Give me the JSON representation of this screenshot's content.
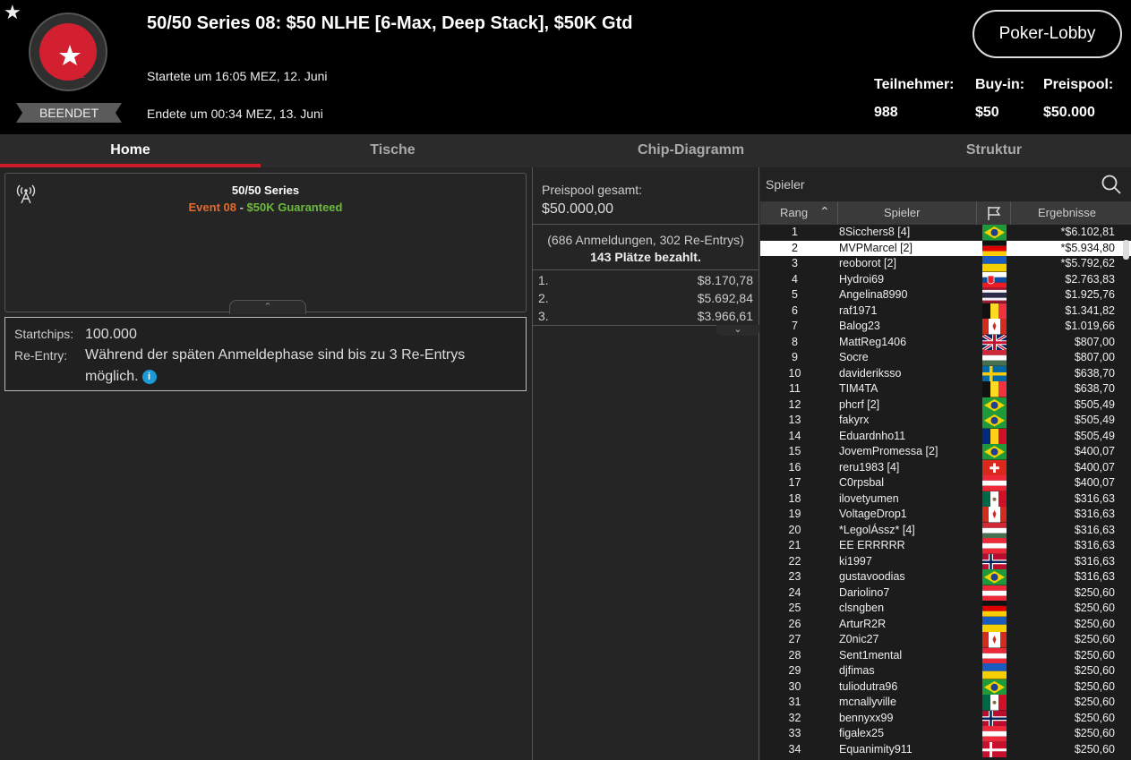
{
  "header": {
    "title": "50/50 Series 08: $50 NLHE [6-Max, Deep Stack], $50K Gtd",
    "started": "Startete um 16:05 MEZ, 12. Juni",
    "ended": "Endete um 00:34 MEZ, 13. Juni",
    "status": "BEENDET",
    "lobby_button": "Poker-Lobby",
    "stats": [
      {
        "label": "Teilnehmer:",
        "value": "988"
      },
      {
        "label": "Buy-in:",
        "value": "$50"
      },
      {
        "label": "Preispool:",
        "value": "$50.000"
      }
    ],
    "logo_color": "#d32030"
  },
  "tabs": [
    "Home",
    "Tische",
    "Chip-Diagramm",
    "Struktur"
  ],
  "active_tab": "Home",
  "info": {
    "series": "50/50 Series",
    "event": "Event 08",
    "separator": " - ",
    "guarantee": "$50K Guaranteed",
    "icon": "broadcast-icon"
  },
  "details": {
    "startchips_label": "Startchips:",
    "startchips_value": "100.000",
    "reentry_label": "Re-Entry:",
    "reentry_value": "Während der späten Anmeldephase sind bis zu 3 Re-Entrys möglich."
  },
  "prizepool": {
    "label": "Preispool gesamt:",
    "value": "$50.000,00",
    "entries": "(686 Anmeldungen, 302 Re-Entrys)",
    "paid": "143 Plätze bezahlt.",
    "prizes": [
      {
        "pos": "1.",
        "amount": "$8.170,78"
      },
      {
        "pos": "2.",
        "amount": "$5.692,84"
      },
      {
        "pos": "3.",
        "amount": "$3.966,61"
      }
    ]
  },
  "players": {
    "search_placeholder": "Spieler",
    "columns": {
      "rank": "Rang",
      "player": "Spieler",
      "result": "Ergebnisse"
    },
    "selected_rank": "2",
    "rows": [
      {
        "rank": "1",
        "name": "8Sicchers8 [4]",
        "flag": "br",
        "result": "*$6.102,81"
      },
      {
        "rank": "2",
        "name": "MVPMarcel [2]",
        "flag": "de",
        "result": "*$5.934,80"
      },
      {
        "rank": "3",
        "name": "reoborot [2]",
        "flag": "ua",
        "result": "*$5.792,62"
      },
      {
        "rank": "4",
        "name": "Hydroi69",
        "flag": "sk",
        "result": "$2.763,83"
      },
      {
        "rank": "5",
        "name": "Angelina8990",
        "flag": "th",
        "result": "$1.925,76"
      },
      {
        "rank": "6",
        "name": "raf1971",
        "flag": "be",
        "result": "$1.341,82"
      },
      {
        "rank": "7",
        "name": "Balog23",
        "flag": "ca",
        "result": "$1.019,66"
      },
      {
        "rank": "8",
        "name": "MattReg1406",
        "flag": "gb",
        "result": "$807,00"
      },
      {
        "rank": "9",
        "name": "Socre",
        "flag": "hu",
        "result": "$807,00"
      },
      {
        "rank": "10",
        "name": "davideriksso",
        "flag": "se",
        "result": "$638,70"
      },
      {
        "rank": "11",
        "name": "TIM4TA",
        "flag": "be",
        "result": "$638,70"
      },
      {
        "rank": "12",
        "name": "phcrf [2]",
        "flag": "br",
        "result": "$505,49"
      },
      {
        "rank": "13",
        "name": "fakyrx",
        "flag": "br",
        "result": "$505,49"
      },
      {
        "rank": "14",
        "name": "Eduardnho11",
        "flag": "ro",
        "result": "$505,49"
      },
      {
        "rank": "15",
        "name": "JovemPromessa [2]",
        "flag": "br",
        "result": "$400,07"
      },
      {
        "rank": "16",
        "name": "reru1983 [4]",
        "flag": "ch",
        "result": "$400,07"
      },
      {
        "rank": "17",
        "name": "C0rpsbal",
        "flag": "at",
        "result": "$400,07"
      },
      {
        "rank": "18",
        "name": "ilovetyumen",
        "flag": "mx",
        "result": "$316,63"
      },
      {
        "rank": "19",
        "name": "VoltageDrop1",
        "flag": "ca",
        "result": "$316,63"
      },
      {
        "rank": "20",
        "name": "*LegolÁssz* [4]",
        "flag": "hu",
        "result": "$316,63"
      },
      {
        "rank": "21",
        "name": "EE ERRRRR",
        "flag": "at",
        "result": "$316,63"
      },
      {
        "rank": "22",
        "name": "ki1997",
        "flag": "no",
        "result": "$316,63"
      },
      {
        "rank": "23",
        "name": "gustavoodias",
        "flag": "br",
        "result": "$316,63"
      },
      {
        "rank": "24",
        "name": "Dariolino7",
        "flag": "at",
        "result": "$250,60"
      },
      {
        "rank": "25",
        "name": "clsngben",
        "flag": "de",
        "result": "$250,60"
      },
      {
        "rank": "26",
        "name": "ArturR2R",
        "flag": "ua",
        "result": "$250,60"
      },
      {
        "rank": "27",
        "name": "Z0nic27",
        "flag": "ca",
        "result": "$250,60"
      },
      {
        "rank": "28",
        "name": "Sent1mental",
        "flag": "at",
        "result": "$250,60"
      },
      {
        "rank": "29",
        "name": "djfimas",
        "flag": "ua",
        "result": "$250,60"
      },
      {
        "rank": "30",
        "name": "tuliodutra96",
        "flag": "br",
        "result": "$250,60"
      },
      {
        "rank": "31",
        "name": "mcnallyville",
        "flag": "mx",
        "result": "$250,60"
      },
      {
        "rank": "32",
        "name": "bennyxx99",
        "flag": "no",
        "result": "$250,60"
      },
      {
        "rank": "33",
        "name": "figalex25",
        "flag": "at",
        "result": "$250,60"
      },
      {
        "rank": "34",
        "name": "Equanimity911",
        "flag": "dk",
        "result": "$250,60"
      }
    ]
  },
  "colors": {
    "accent_red": "#d11a2a",
    "event_orange": "#e26a2c",
    "guarantee_green": "#6cbb3c",
    "info_blue": "#1b9ad6"
  }
}
